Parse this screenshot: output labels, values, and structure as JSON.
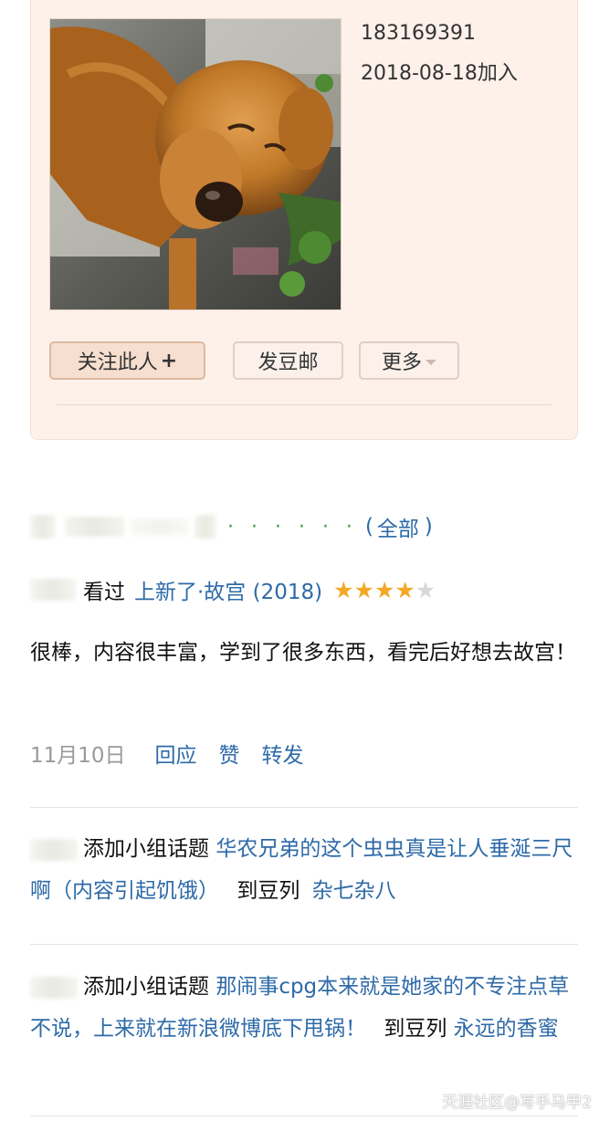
{
  "profile": {
    "user_id": "183169391",
    "join_date": "2018-08-18加入",
    "avatar_icon": "dog-photo",
    "buttons": {
      "follow": "关注此人",
      "follow_plus": "+",
      "message": "发豆邮",
      "more": "更多"
    }
  },
  "broadcast": {
    "dots": "· · · · · ·",
    "all_link": "全部",
    "paren_open": "(",
    "paren_close": ")"
  },
  "activity1": {
    "verb": "看过",
    "title": "上新了·故宫 (2018)",
    "rating": 4,
    "rating_max": 5,
    "review": "很棒，内容很丰富，学到了很多东西，看完后好想去故宫！",
    "date": "11月10日",
    "actions": [
      "回应",
      "赞",
      "转发"
    ]
  },
  "activity2": {
    "verb": "添加小组话题",
    "topic": "华农兄弟的这个虫虫真是让人垂涎三尺啊（内容引起饥饿）",
    "to": "到豆列",
    "list": "杂七杂八"
  },
  "activity3": {
    "verb": "添加小组话题",
    "topic": "那闹事cpg本来就是她家的不专注点草不说，上来就在新浪微博底下甩锅！",
    "to": "到豆列",
    "list": "永远的香蜜"
  },
  "watermark": "天涯社区@写手马甲2",
  "colors": {
    "card_bg": "#fdf1ea",
    "link": "#2e6aa8",
    "star": "#f4a826",
    "dots": "#3a9a4a"
  }
}
